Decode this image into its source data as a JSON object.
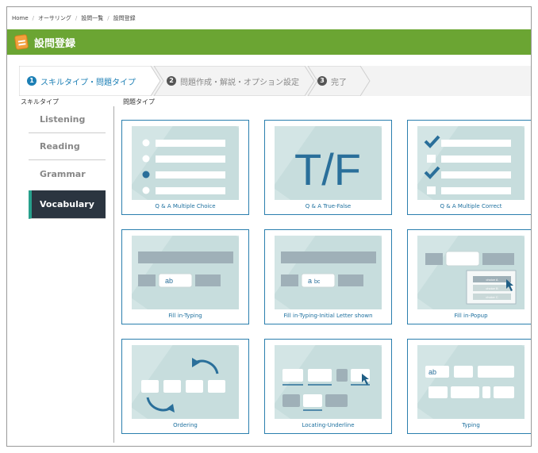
{
  "breadcrumb": {
    "items": [
      "Home",
      "オーサリング",
      "設問一覧",
      "設問登録"
    ],
    "separator": "/"
  },
  "title": "設問登録",
  "steps": [
    {
      "number": "1",
      "label": "スキルタイプ・問題タイプ"
    },
    {
      "number": "2",
      "label": "問題作成・解説・オプション設定"
    },
    {
      "number": "3",
      "label": "完了"
    }
  ],
  "sidebar": {
    "label": "スキルタイプ",
    "items": [
      "Listening",
      "Reading",
      "Grammar",
      "Vocabulary"
    ],
    "active": "Vocabulary"
  },
  "grid": {
    "label": "問題タイプ",
    "cards": [
      {
        "caption": "Q & A Multiple Choice",
        "icon": "multiple-choice-icon"
      },
      {
        "caption": "Q & A True-False",
        "icon": "true-false-icon",
        "art_text": "T/F"
      },
      {
        "caption": "Q & A Multiple Correct",
        "icon": "multiple-correct-icon"
      },
      {
        "caption": "Fill in-Typing",
        "icon": "fill-typing-icon",
        "art_text": "ab"
      },
      {
        "caption": "Fill in-Typing-Initial Letter shown",
        "icon": "fill-initial-letter-icon",
        "art_text": "a",
        "art_text2": "bc"
      },
      {
        "caption": "Fill in-Popup",
        "icon": "fill-popup-icon",
        "art_options": [
          "choice A",
          "choice B",
          "choice C"
        ]
      },
      {
        "caption": "Ordering",
        "icon": "ordering-icon"
      },
      {
        "caption": "Locating-Underline",
        "icon": "locating-underline-icon"
      },
      {
        "caption": "Typing",
        "icon": "typing-icon",
        "art_text": "ab"
      }
    ]
  },
  "colors": {
    "title_bar": "#6ba533",
    "step_active": "#1c7fb5",
    "card_border": "#2b7fae",
    "thumb_bg": "#d3e5e5",
    "sidebar_active_bg": "#2b3540",
    "sidebar_active_accent": "#27a08c"
  }
}
